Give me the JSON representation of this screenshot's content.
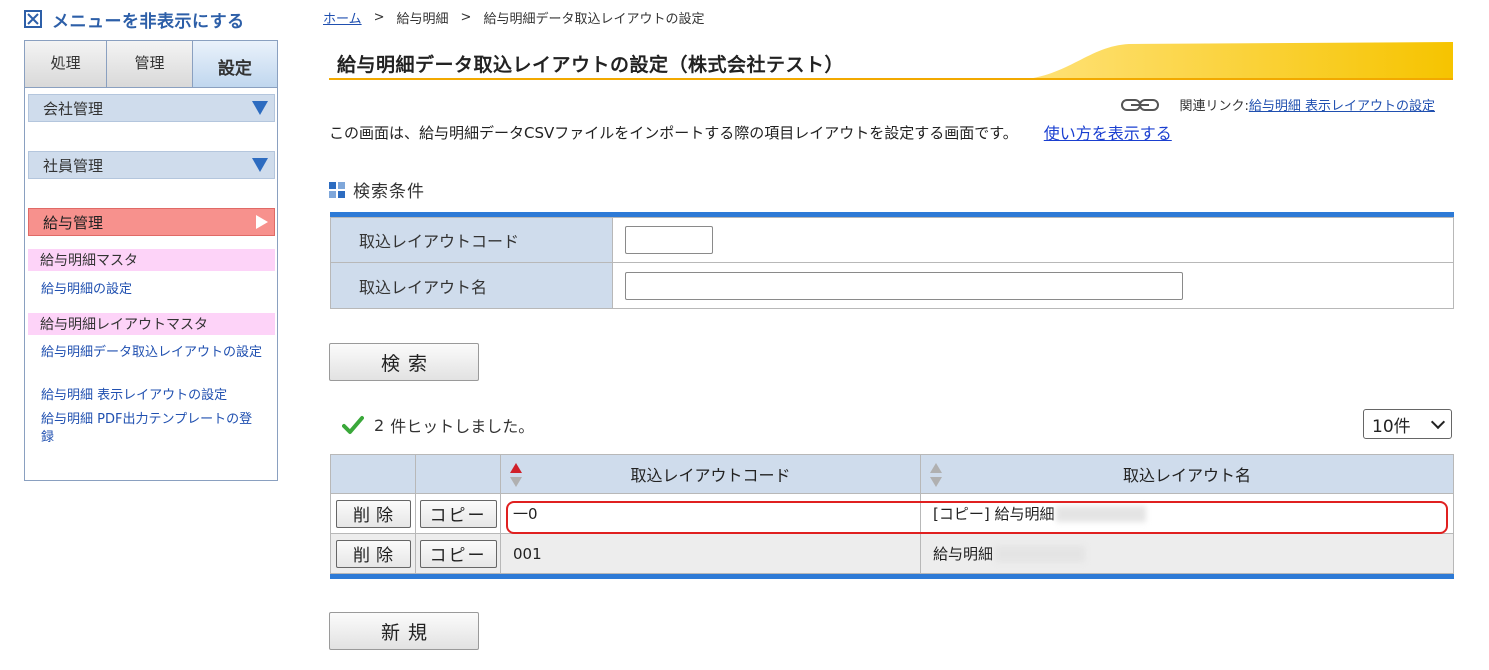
{
  "sidebar": {
    "toggle_label": "メニューを非表示にする",
    "tabs": [
      {
        "label": "処理"
      },
      {
        "label": "管理"
      },
      {
        "label": "設定"
      }
    ],
    "sections": {
      "company": "会社管理",
      "employee": "社員管理",
      "payroll": "給与管理"
    },
    "groups": {
      "payslip_master": "給与明細マスタ",
      "payslip_settings": "給与明細の設定",
      "layout_master": "給与明細レイアウトマスタ",
      "import_layout": "給与明細データ取込レイアウトの設定",
      "display_layout": "給与明細 表示レイアウトの設定",
      "pdf_template": "給与明細 PDF出力テンプレートの登録"
    }
  },
  "breadcrumb": {
    "home": "ホーム",
    "sep": ">",
    "level1": "給与明細",
    "level2": "給与明細データ取込レイアウトの設定"
  },
  "page": {
    "title": "給与明細データ取込レイアウトの設定（株式会社テスト）",
    "related_label": "関連リンク:",
    "related_link": "給与明細 表示レイアウトの設定",
    "description": "この画面は、給与明細データCSVファイルをインポートする際の項目レイアウトを設定する画面です。",
    "help_link": "使い方を表示する",
    "search_heading": "検索条件"
  },
  "search": {
    "code_label": "取込レイアウトコード",
    "code_value": "",
    "name_label": "取込レイアウト名",
    "name_value": "",
    "search_button": "検索"
  },
  "results": {
    "hit_count": "2",
    "hit_suffix": "件ヒットしました。",
    "per_page": "10件",
    "columns": {
      "code": "取込レイアウトコード",
      "name": "取込レイアウト名"
    },
    "delete_label": "削除",
    "copy_label": "コピー",
    "rows": [
      {
        "code": "一0",
        "name": "[コピー] 給与明細"
      },
      {
        "code": "001",
        "name": "給与明細"
      }
    ]
  },
  "new_button": "新規",
  "colors": {
    "accent_blue": "#2d7ad6",
    "label_bg": "#cfdcec",
    "payroll_section": "#f7918d",
    "subhead_pink": "#fdd3f8",
    "link": "#2050b0",
    "highlight_red": "#e02020"
  }
}
